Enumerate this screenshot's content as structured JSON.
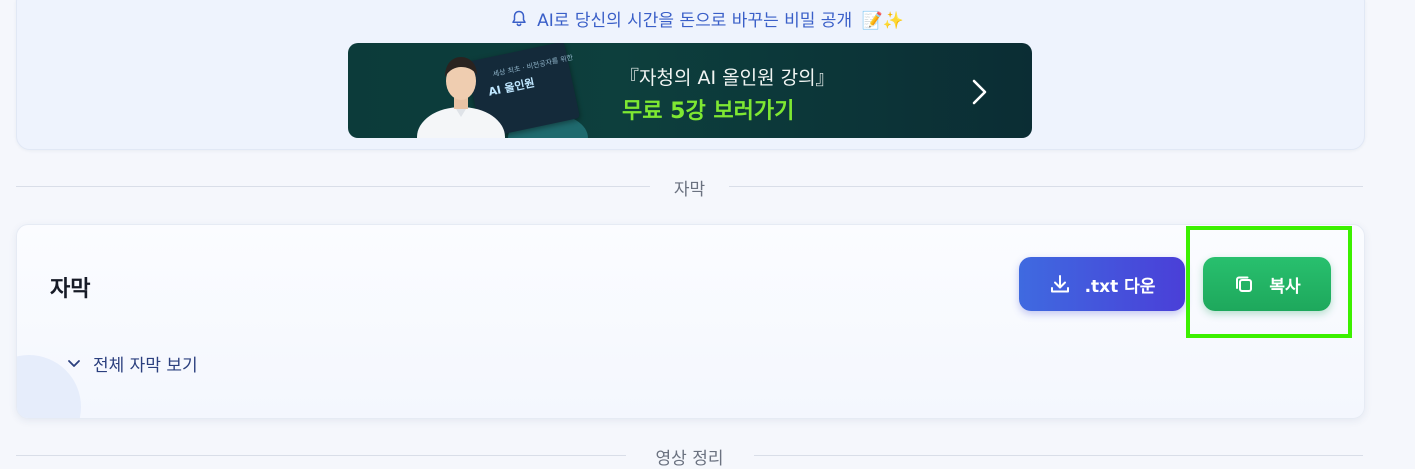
{
  "promo": {
    "title": "AI로 당신의 시간을 돈으로 바꾸는 비밀 공개",
    "title_emoji": "📝✨",
    "banner": {
      "line1": "『자청의 AI 올인원 강의』",
      "line2": "무료 5강 보러가기",
      "book_label": "AI 올인원",
      "book_small": "세상 최초 · 비전공자를 위한"
    }
  },
  "dividers": {
    "subtitles": "자막",
    "video_summary": "영상 정리"
  },
  "subtitles_card": {
    "title": "자막",
    "download_button": ".txt 다운",
    "copy_button": "복사",
    "toggle_label": "전체 자막 보기"
  },
  "colors": {
    "accent_blue": "#3f6ae0",
    "accent_green": "#28c06e",
    "highlight": "#3cf000",
    "banner_cta": "#7ee832"
  },
  "icons": {
    "bell": "bell-icon",
    "chevron_right": "chevron-right-icon",
    "download": "download-icon",
    "copy": "copy-icon",
    "chevron_down": "chevron-down-icon"
  }
}
